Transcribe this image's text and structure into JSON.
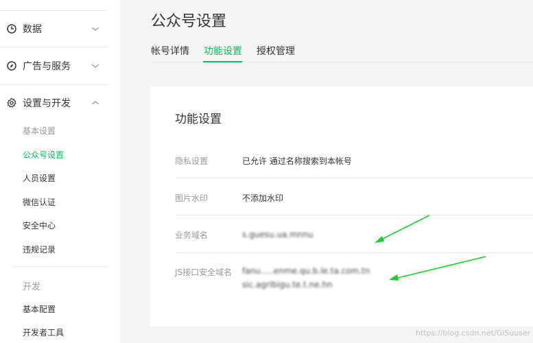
{
  "sidebar": {
    "groups": [
      {
        "label": "数据",
        "icon": "clock-icon",
        "chevron": "down"
      },
      {
        "label": "广告与服务",
        "icon": "compass-icon",
        "chevron": "down"
      },
      {
        "label": "设置与开发",
        "icon": "gear-icon",
        "chevron": "up"
      }
    ],
    "section_basic": "基本设置",
    "items": [
      "公众号设置",
      "人员设置",
      "微信认证",
      "安全中心",
      "违规记录"
    ],
    "section_dev": "开发",
    "dev_items": [
      "基本配置",
      "开发者工具"
    ]
  },
  "main": {
    "title": "公众号设置",
    "tabs": [
      "帐号详情",
      "功能设置",
      "授权管理"
    ],
    "card": {
      "title": "功能设置",
      "rows": [
        {
          "label": "隐私设置",
          "value": "已允许 通过名称搜索到本帐号"
        },
        {
          "label": "图片水印",
          "value": "不添加水印"
        },
        {
          "label": "业务域名",
          "value": "s.guesu.ua.mnnu"
        },
        {
          "label": "JS接口安全域名",
          "value": "fanu.....enme.qu.b.le.ta.com.tn",
          "value2": "sic.agribigu.te.t.ne.hn"
        }
      ]
    }
  },
  "watermark": "https://blog.csdn.net/GiSuuser",
  "colors": {
    "accent": "#07c160",
    "annotation_arrow": "#19d02a"
  }
}
